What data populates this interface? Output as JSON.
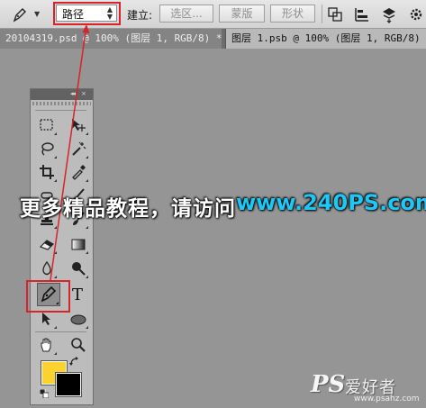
{
  "options_bar": {
    "mode_value": "路径",
    "make_label": "建立:",
    "selection_button": "选区...",
    "mask_button": "蒙版",
    "shape_button": "形状"
  },
  "tabs": [
    {
      "label": "20104319.psd @ 100% (图层 1, RGB/8) *",
      "close": "×"
    },
    {
      "label": "图层 1.psb @ 100% (图层 1, RGB/8) *",
      "close": "×"
    }
  ],
  "tools_panel": {
    "collapse": "◂◂",
    "active_tool": "pen-tool",
    "type_tool_glyph": "T",
    "foreground_color": "#fcd22e",
    "background_color": "#000000"
  },
  "watermark": {
    "text": "更多精品教程，请访问",
    "url": "www.240PS.com"
  },
  "logo": {
    "ps": "PS",
    "cn": "爱好者",
    "domain": "www.psahz.com"
  },
  "annotation_color": "#d8232a"
}
